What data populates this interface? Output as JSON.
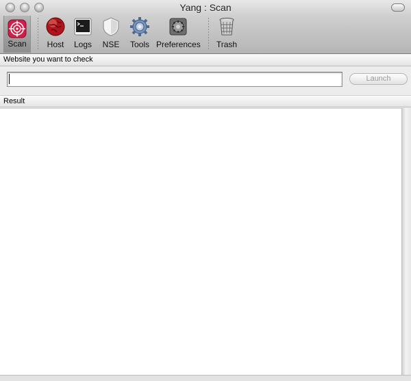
{
  "window": {
    "title": "Yang : Scan"
  },
  "toolbar": {
    "items": [
      {
        "label": "Scan",
        "icon": "target-icon"
      },
      {
        "label": "Host",
        "icon": "globe-icon"
      },
      {
        "label": "Logs",
        "icon": "terminal-icon"
      },
      {
        "label": "NSE",
        "icon": "shield-icon"
      },
      {
        "label": "Tools",
        "icon": "gear-icon"
      },
      {
        "label": "Preferences",
        "icon": "preferences-icon"
      },
      {
        "label": "Trash",
        "icon": "trash-icon"
      }
    ],
    "selected": "Scan"
  },
  "form": {
    "website_label": "Website you want to check",
    "website_value": "",
    "launch_label": "Launch"
  },
  "result": {
    "label": "Result",
    "content": ""
  },
  "colors": {
    "scan_accent": "#d21f4a",
    "host_accent": "#b0141c"
  }
}
